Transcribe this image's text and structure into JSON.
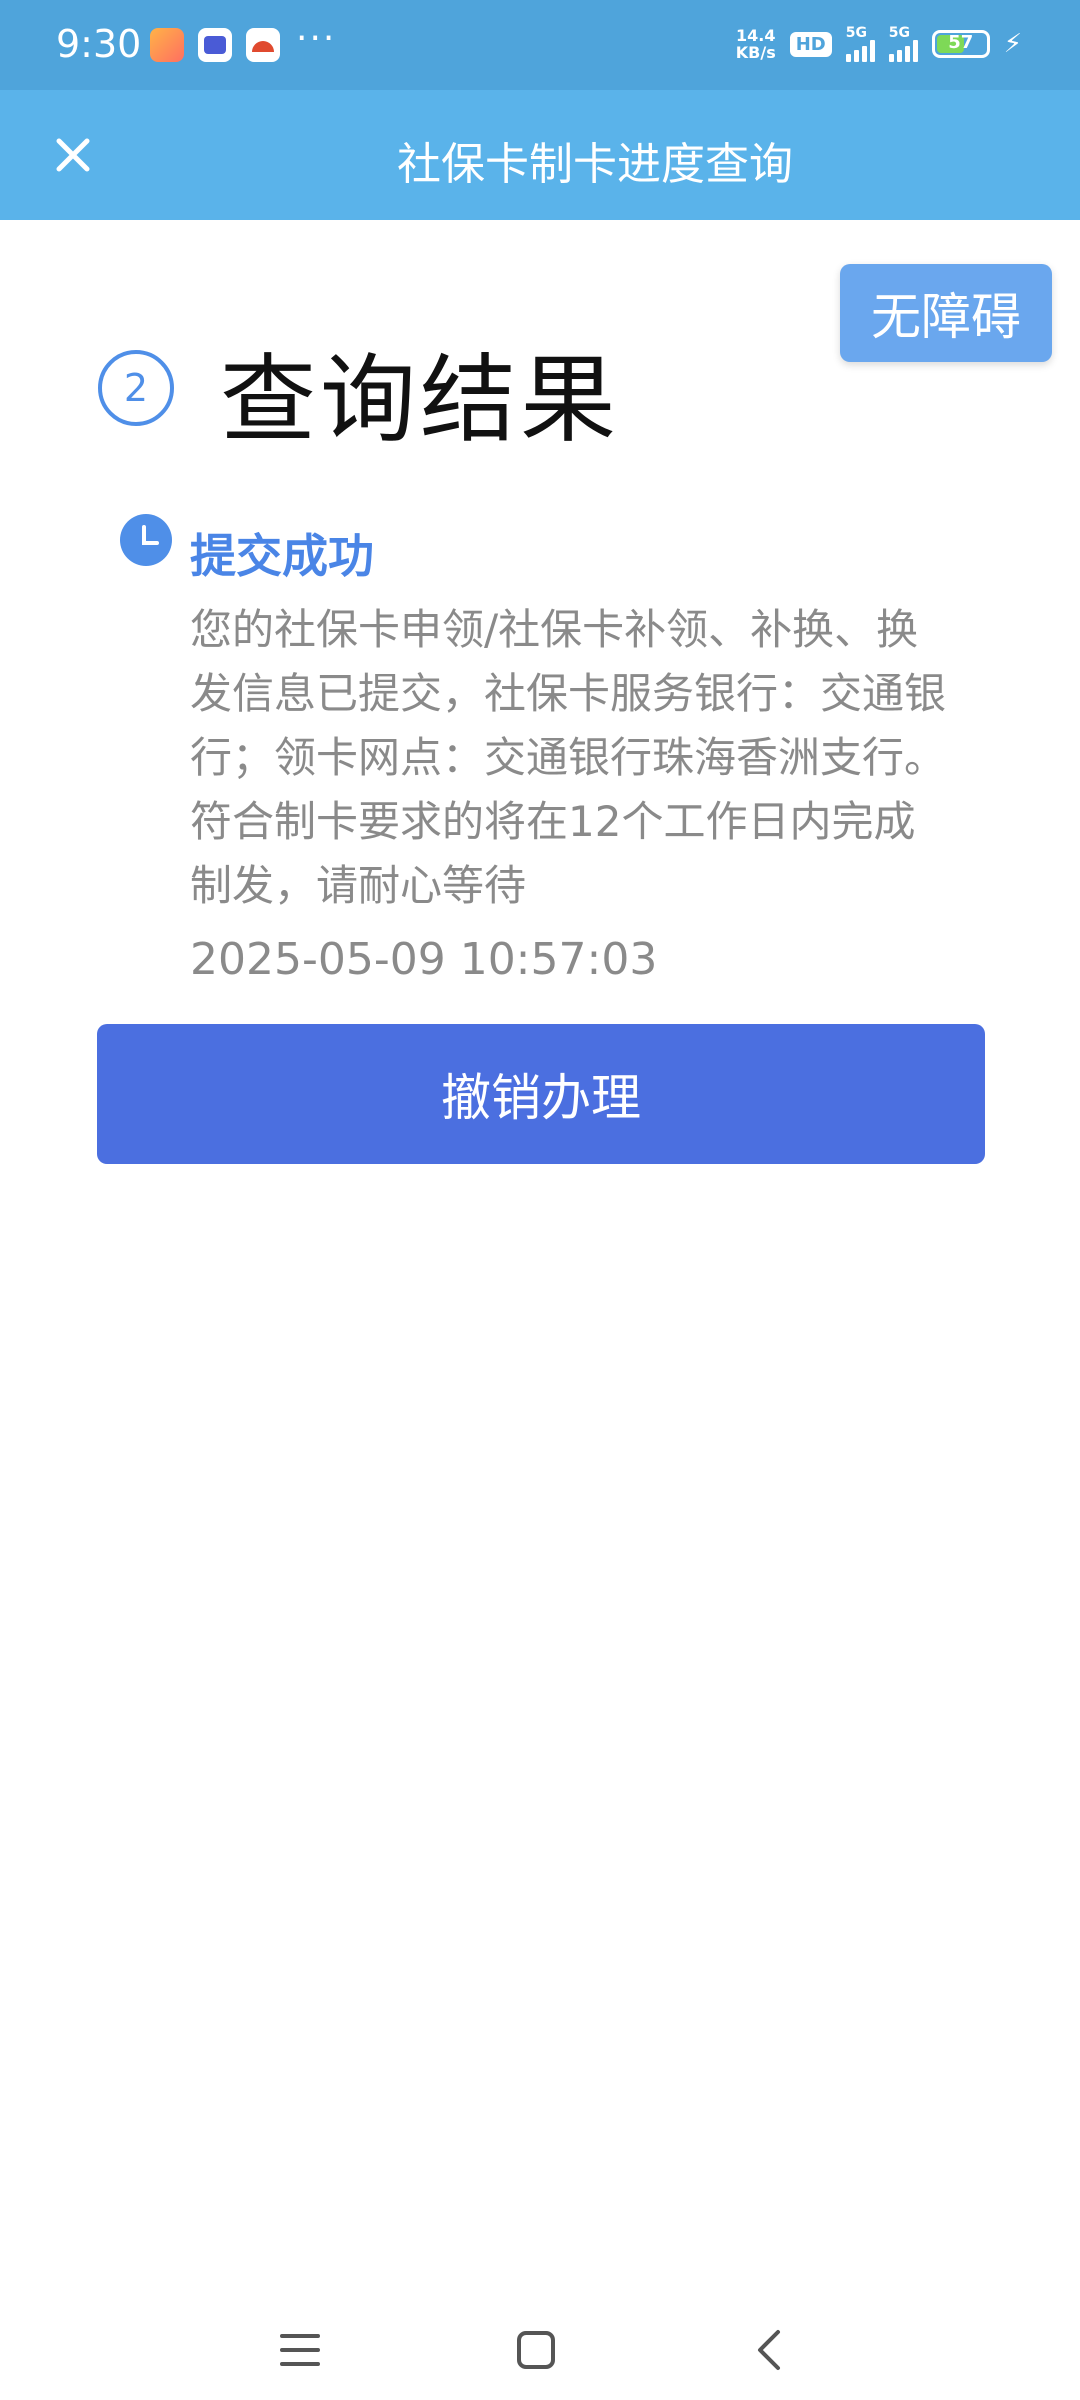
{
  "status_bar": {
    "time": "9:30",
    "more": "···",
    "speed_value": "14.4",
    "speed_unit": "KB/s",
    "hd": "HD",
    "signal1": "5G",
    "signal2": "5G",
    "battery": "57",
    "battery_level": 0.57,
    "icons": [
      "app-icon-game",
      "app-icon-tieba",
      "app-icon-orange",
      "hd-icon",
      "signal-icon",
      "battery-icon",
      "charging-icon"
    ]
  },
  "header": {
    "title": "社保卡制卡进度查询",
    "close_icon": "close-icon"
  },
  "accessibility": {
    "label": "无障碍"
  },
  "step": {
    "number": "2",
    "title": "查询结果"
  },
  "status": {
    "icon": "clock-icon",
    "title": "提交成功",
    "description": "您的社保卡申领/社保卡补领、补换、换发信息已提交，社保卡服务银行：交通银行；领卡网点：交通银行珠海香洲支行。符合制卡要求的将在12个工作日内完成制发，请耐心等待",
    "timestamp": "2025-05-09 10:57:03"
  },
  "actions": {
    "revoke_label": "撤销办理"
  },
  "nav": {
    "menu": "menu-icon",
    "home": "home-icon",
    "back": "back-icon"
  },
  "colors": {
    "status_bar": "#4fa4db",
    "header": "#5ab3ea",
    "accent": "#4a85e6",
    "button": "#4b6fe0",
    "a11y_button": "#6aa7ee"
  }
}
